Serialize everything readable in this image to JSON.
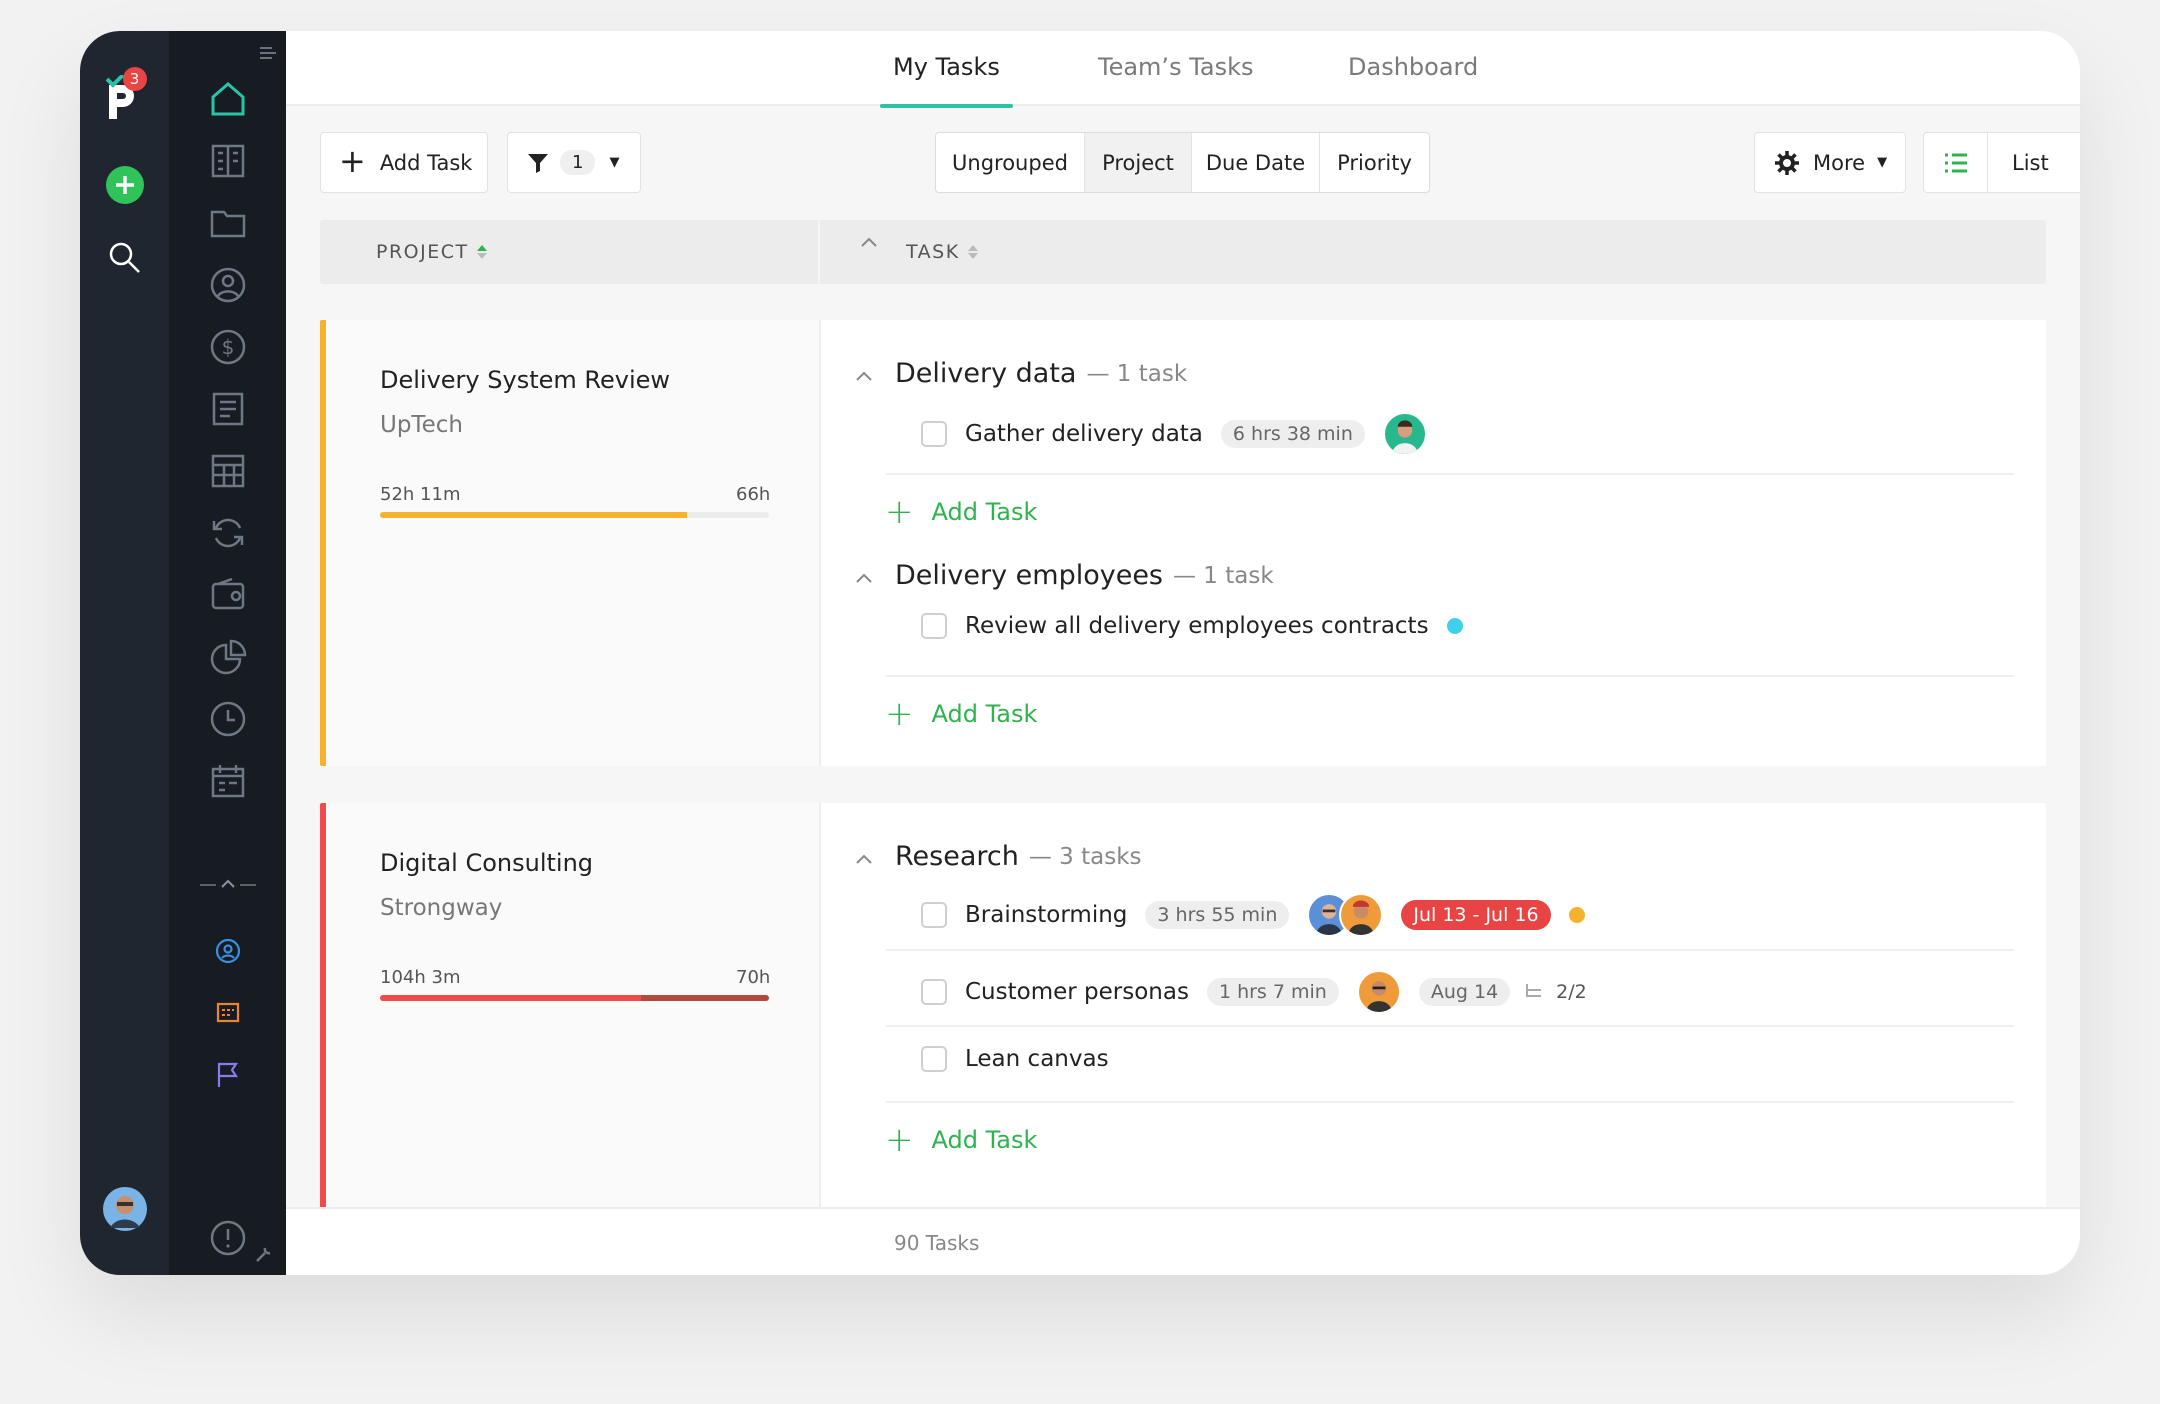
{
  "app": {
    "notification_count": "3"
  },
  "nav": {
    "tabs": [
      {
        "label": "My Tasks",
        "active": true
      },
      {
        "label": "Team’s Tasks",
        "active": false
      },
      {
        "label": "Dashboard",
        "active": false
      }
    ]
  },
  "toolbar": {
    "add_task_label": "Add Task",
    "filter_count": "1",
    "grouping": [
      "Ungrouped",
      "Project",
      "Due Date",
      "Priority"
    ],
    "grouping_active": "Project",
    "more_label": "More",
    "view_label": "List"
  },
  "table_header": {
    "project_label": "PROJECT",
    "task_label": "TASK"
  },
  "projects": [
    {
      "name": "Delivery System Review",
      "client": "UpTech",
      "logged": "52h 11m",
      "budget": "66h",
      "progress": 0.79,
      "color": "#f6b12d",
      "groups": [
        {
          "name": "Delivery data",
          "count": "— 1 task",
          "tasks": [
            {
              "title": "Gather delivery data",
              "time": "6 hrs 38 min"
            }
          ]
        },
        {
          "name": "Delivery employees",
          "count": "— 1 task",
          "tasks": [
            {
              "title": "Review all delivery employees contracts",
              "dot_color": "#3fd0ea"
            }
          ]
        }
      ],
      "add_task_label": "Add Task"
    },
    {
      "name": "Digital Consulting",
      "client": "Strongway",
      "logged": "104h 3m",
      "budget": "70h",
      "progress": 1.0,
      "over_budget_start": 0.67,
      "color": "#ef4b4b",
      "groups": [
        {
          "name": "Research",
          "count": "— 3 tasks",
          "tasks": [
            {
              "title": "Brainstorming",
              "time": "3 hrs 55 min",
              "date": "Jul 13 - Jul 16",
              "dot_color": "#f6b12d"
            },
            {
              "title": "Customer personas",
              "time": "1 hrs 7 min",
              "date": "Aug 14",
              "subtasks": "2/2"
            },
            {
              "title": "Lean canvas"
            }
          ]
        }
      ],
      "add_task_label": "Add Task"
    }
  ],
  "footer": {
    "count_label": "90 Tasks"
  },
  "colors": {
    "accent": "#29c3a8",
    "green": "#2fb34e",
    "rail": "#20262f",
    "rail_dark": "#171c23"
  }
}
